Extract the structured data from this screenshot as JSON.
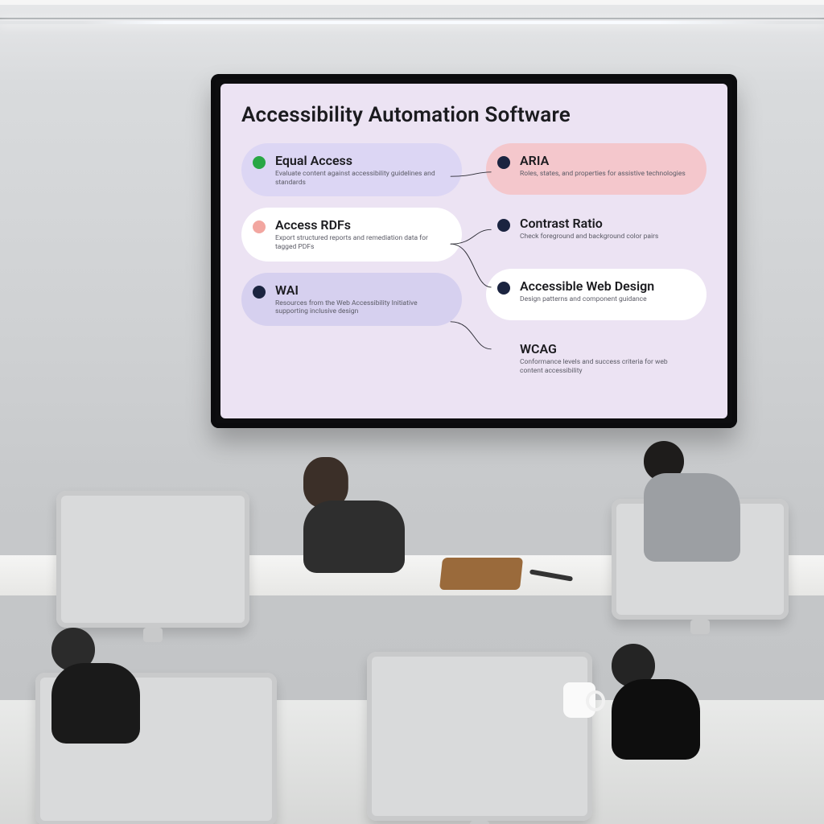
{
  "slide": {
    "title": "Accessibility Automation Software",
    "left": [
      {
        "label": "Equal Access",
        "desc": "Evaluate content against accessibility guidelines and standards",
        "dot": "#28a745",
        "bg": "bg-lilac"
      },
      {
        "label": "Access RDFs",
        "desc": "Export structured reports and remediation data for tagged PDFs",
        "dot": "#f2a6a0",
        "bg": "bg-white"
      },
      {
        "label": "WAI",
        "desc": "Resources from the Web Accessibility Initiative supporting inclusive design",
        "dot": "#1b2440",
        "bg": "bg-lav"
      }
    ],
    "right": [
      {
        "label": "ARIA",
        "desc": "Roles, states, and properties for assistive technologies",
        "dot": "#1b2440",
        "bg": "bg-pink"
      },
      {
        "label": "Contrast Ratio",
        "desc": "Check foreground and background color pairs",
        "dot": "#1b2440",
        "bg": "bg-ghost"
      },
      {
        "label": "Accessible Web Design",
        "desc": "Design patterns and component guidance",
        "dot": "#1b2440",
        "bg": "bg-white"
      },
      {
        "label": "WCAG",
        "desc": "Conformance levels and success criteria for web content accessibility",
        "dot": "",
        "bg": "bg-ghost"
      }
    ]
  },
  "colors": {
    "slide_bg": "#ece3f3",
    "lilac": "#dcd6f4",
    "lavender": "#d6d0ef",
    "pink": "#f4c7cc",
    "green_dot": "#28a745",
    "salmon_dot": "#f2a6a0",
    "navy_dot": "#1b2440"
  }
}
